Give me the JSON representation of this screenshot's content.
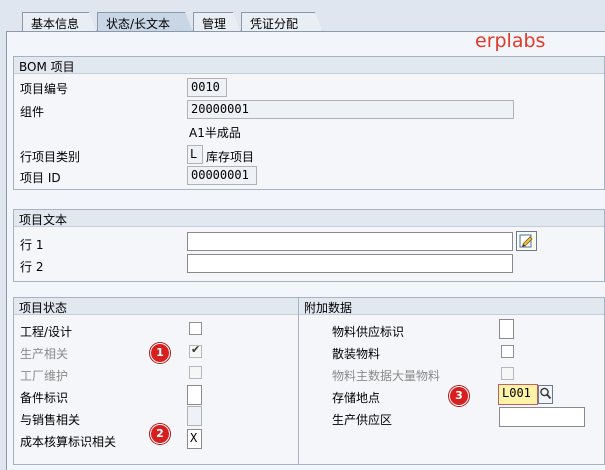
{
  "tabs": [
    "基本信息",
    "状态/长文本",
    "管理",
    "凭证分配"
  ],
  "watermark": "erplabs",
  "bom_item": {
    "title": "BOM 项目",
    "item_number_label": "项目编号",
    "item_number": "0010",
    "component_label": "组件",
    "component": "20000001",
    "component_desc": "A1半成品",
    "item_category_label": "行项目类别",
    "item_category": "L",
    "item_category_desc": "库存项目",
    "item_id_label": "项目 ID",
    "item_id": "00000001"
  },
  "item_text": {
    "title": "项目文本",
    "line1_label": "行 1",
    "line1": "",
    "line2_label": "行 2",
    "line2": ""
  },
  "item_status": {
    "title": "项目状态",
    "engineering_label": "工程/设计",
    "engineering_checked": false,
    "production_label": "生产相关",
    "production_checked": true,
    "plant_maint_label": "工厂维护",
    "plant_maint_checked": false,
    "spare_part_label": "备件标识",
    "spare_part": "",
    "sales_label": "与销售相关",
    "sales": "",
    "costing_label": "成本核算标识相关",
    "costing": "X"
  },
  "additional_data": {
    "title": "附加数据",
    "material_provision_label": "物料供应标识",
    "material_provision": "",
    "bulk_material_label": "散装物料",
    "bulk_material_checked": false,
    "bulk_master_label": "物料主数据大量物料",
    "bulk_master_checked": false,
    "storage_location_label": "存储地点",
    "storage_location": "L001",
    "supply_area_label": "生产供应区",
    "supply_area": ""
  },
  "annotations": [
    "1",
    "2",
    "3"
  ],
  "colors": {
    "badge": "#d71f1f",
    "highlight_field": "#fff3a8",
    "watermark": "#e03a2a"
  }
}
